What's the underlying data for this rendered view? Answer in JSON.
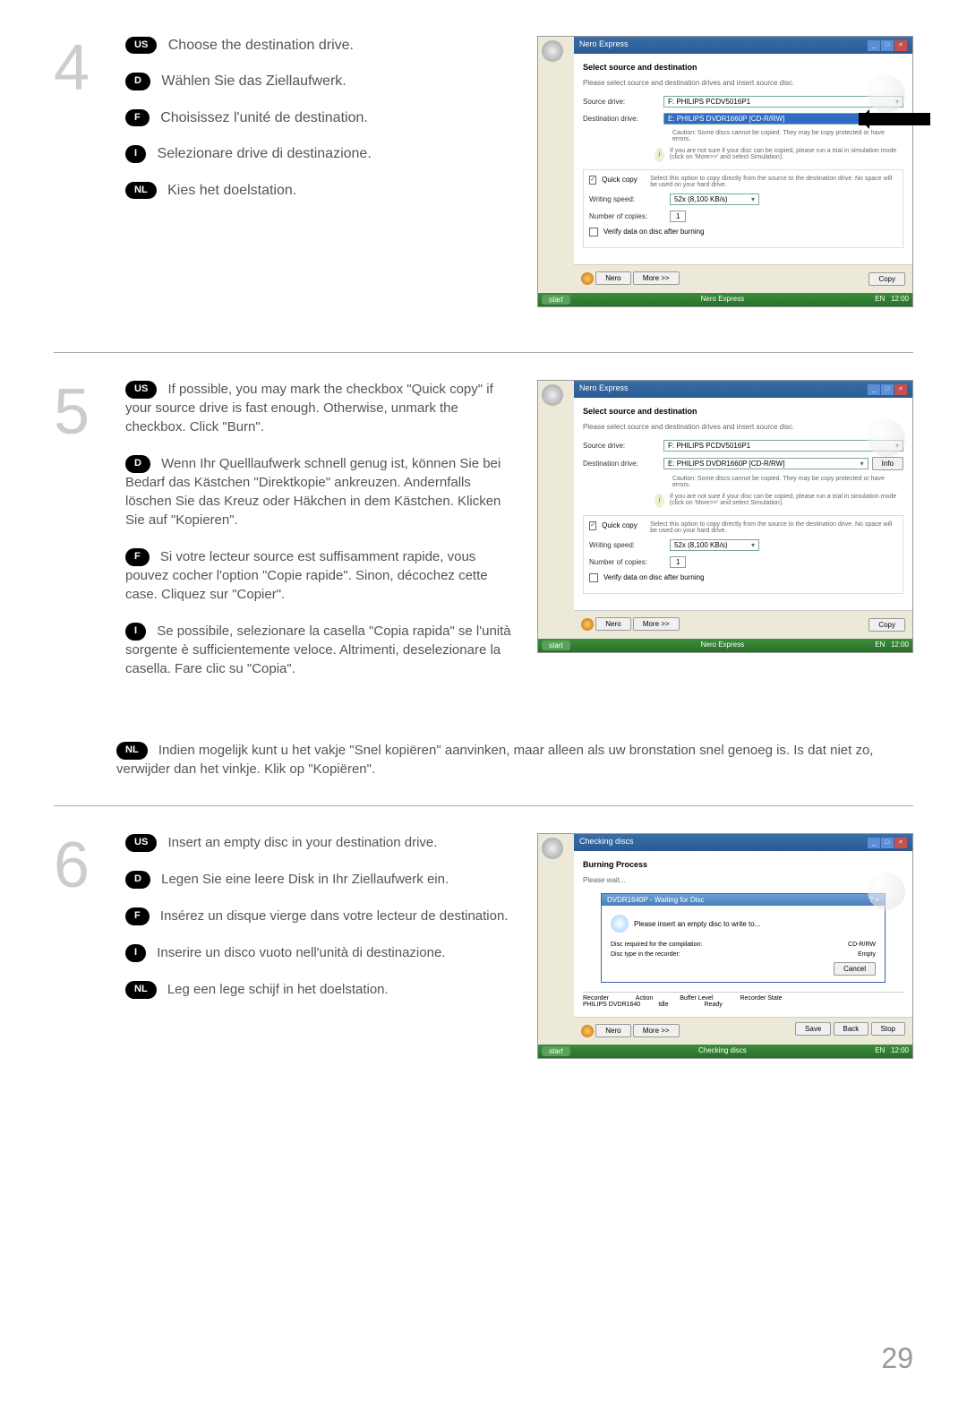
{
  "page_number": "29",
  "steps": {
    "step4": {
      "number": "4",
      "us": "Choose the destination drive.",
      "d": "Wählen Sie das Ziellaufwerk.",
      "f": "Choisissez l'unité de destination.",
      "i": "Selezionare drive di destinazione.",
      "nl": "Kies het doelstation."
    },
    "step5": {
      "number": "5",
      "us": "If possible, you may mark the checkbox \"Quick copy\" if your source drive is fast enough. Otherwise, unmark the checkbox. Click \"Burn\".",
      "d": "Wenn Ihr Quelllaufwerk schnell genug ist, können Sie bei Bedarf das Kästchen \"Direktkopie\" ankreuzen. Andernfalls löschen Sie das Kreuz oder Häkchen in dem Kästchen. Klicken Sie auf \"Kopieren\".",
      "f": "Si votre lecteur source est suffisamment rapide, vous pouvez cocher l'option \"Copie rapide\". Sinon, décochez cette case. Cliquez sur \"Copier\".",
      "i": "Se possibile, selezionare la casella \"Copia rapida\" se l'unità sorgente è sufficientemente veloce. Altrimenti, deselezionare la casella. Fare clic su \"Copia\".",
      "nl": "Indien mogelijk kunt u het vakje \"Snel kopiëren\" aanvinken, maar alleen als uw bronstation snel genoeg is. Is dat niet zo, verwijder dan het vinkje. Klik op \"Kopiëren\"."
    },
    "step6": {
      "number": "6",
      "us": "Insert an empty disc in your destination drive.",
      "d": "Legen Sie eine leere Disk in Ihr Ziellaufwerk ein.",
      "f": "Insérez un disque vierge dans votre lecteur de destination.",
      "i": "Inserire un disco vuoto nell'unità di destinazione.",
      "nl": "Leg een lege schijf in het doelstation."
    }
  },
  "badges": {
    "us": "US",
    "d": "D",
    "f": "F",
    "i": "I",
    "nl": "NL"
  },
  "screenshot1": {
    "app_title": "Nero Express",
    "section_title": "Select source and destination",
    "subtitle": "Please select source and destination drives and insert source disc.",
    "source_label": "Source drive:",
    "source_value": "F: PHILIPS PCDV5016P1",
    "dest_label": "Destination drive:",
    "dest_value": "E: PHILIPS DVDR1660P",
    "dest_tag": "[CD-R/RW]",
    "caution": "Caution: Some discs cannot be copied. They may be copy protected or have errors.",
    "info_text": "If you are not sure if your disc can be copied, please run a trial in simulation mode (click on 'More>>' and select Simulation).",
    "quick_copy_label": "Quick copy",
    "quick_copy_desc": "Select this option to copy directly from the source to the destination drive. No space will be used on your hard drive.",
    "writing_speed_label": "Writing speed:",
    "writing_speed_value": "52x (8,100 KB/s)",
    "copies_label": "Number of copies:",
    "copies_value": "1",
    "verify_label": "Verify data on disc after burning",
    "nero_btn": "Nero",
    "more_btn": "More >>",
    "copy_btn": "Copy",
    "start_btn": "start",
    "taskbar_item": "Nero Express"
  },
  "screenshot2": {
    "app_title": "Nero Express",
    "section_title": "Select source and destination",
    "subtitle": "Please select source and destination drives and insert source disc.",
    "source_label": "Source drive:",
    "source_value": "F: PHILIPS PCDV5016P1",
    "dest_label": "Destination drive:",
    "dest_value": "E: PHILIPS DVDR1660P",
    "dest_tag": "[CD-R/RW]",
    "info_btn": "Info",
    "caution": "Caution: Some discs cannot be copied. They may be copy protected or have errors.",
    "info_text": "If you are not sure if your disc can be copied, please run a trial in simulation mode (click on 'More>>' and select Simulation).",
    "quick_copy_label": "Quick copy",
    "quick_copy_desc": "Select this option to copy directly from the source to the destination drive. No space will be used on your hard drive.",
    "writing_speed_label": "Writing speed:",
    "writing_speed_value": "52x (8,100 KB/s)",
    "copies_label": "Number of copies:",
    "copies_value": "1",
    "verify_label": "Verify data on disc after burning",
    "nero_btn": "Nero",
    "more_btn": "More >>",
    "copy_btn": "Copy",
    "start_btn": "start",
    "taskbar_item": "Nero Express"
  },
  "screenshot3": {
    "app_title": "Checking discs",
    "burning_title": "Burning Process",
    "please_wait": "Please wait...",
    "dialog_title": "DVDR1640P - Waiting for Disc",
    "dialog_msg": "Please insert an empty disc to write to...",
    "disc_req_label": "Disc required for the compilation:",
    "disc_req_value": "CD-R/RW",
    "disc_type_label": "Disc type in the recorder:",
    "disc_type_value": "Empty",
    "cancel_btn": "Cancel",
    "recorder_col": "Recorder",
    "action_col": "Action",
    "buffer_col": "Buffer Level",
    "state_col": "Recorder State",
    "recorder_val": "PHILIPS DVDR1640",
    "action_val": "Idle",
    "state_val": "Ready",
    "nero_btn": "Nero",
    "more_btn": "More >>",
    "save_btn": "Save",
    "back_btn": "Back",
    "stop_btn": "Stop",
    "start_btn": "start",
    "taskbar_item": "Checking discs"
  }
}
